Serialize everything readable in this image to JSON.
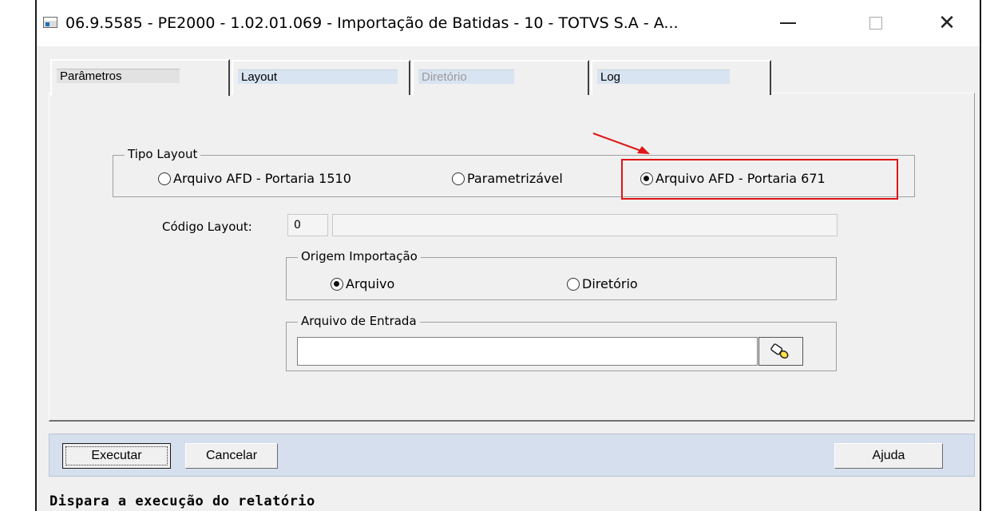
{
  "window": {
    "title": "06.9.5585 - PE2000 - 1.02.01.069 - Importação de Batidas - 10 - TOTVS S.A - A...",
    "controls": {
      "minimize": "minimize",
      "maximize": "maximize",
      "close": "close"
    }
  },
  "tabs": [
    {
      "label": "Parâmetros",
      "active": true,
      "enabled": true
    },
    {
      "label": "Layout",
      "active": false,
      "enabled": true
    },
    {
      "label": "Diretório",
      "active": false,
      "enabled": false
    },
    {
      "label": "Log",
      "active": false,
      "enabled": true
    }
  ],
  "tipo_layout": {
    "caption": "Tipo Layout",
    "options": [
      {
        "label": "Arquivo AFD - Portaria 1510",
        "selected": false
      },
      {
        "label": "Parametrizável",
        "selected": false
      },
      {
        "label": "Arquivo AFD - Portaria 671",
        "selected": true
      }
    ]
  },
  "codigo_layout": {
    "label": "Código Layout:",
    "value": "0",
    "description": ""
  },
  "origem_importacao": {
    "caption": "Origem Importação",
    "options": [
      {
        "label": "Arquivo",
        "selected": true
      },
      {
        "label": "Diretório",
        "selected": false
      }
    ]
  },
  "arquivo_entrada": {
    "caption": "Arquivo de Entrada",
    "value": "",
    "browse_icon": "flashlight-icon"
  },
  "buttons": {
    "execute": "Executar",
    "cancel": "Cancelar",
    "help": "Ajuda"
  },
  "status_bar": {
    "text": "Dispara a execução do relatório"
  },
  "colors": {
    "highlight": "#e01414",
    "button_bar": "#d6dfee",
    "tab_label_bg": "#d9e4f2"
  }
}
